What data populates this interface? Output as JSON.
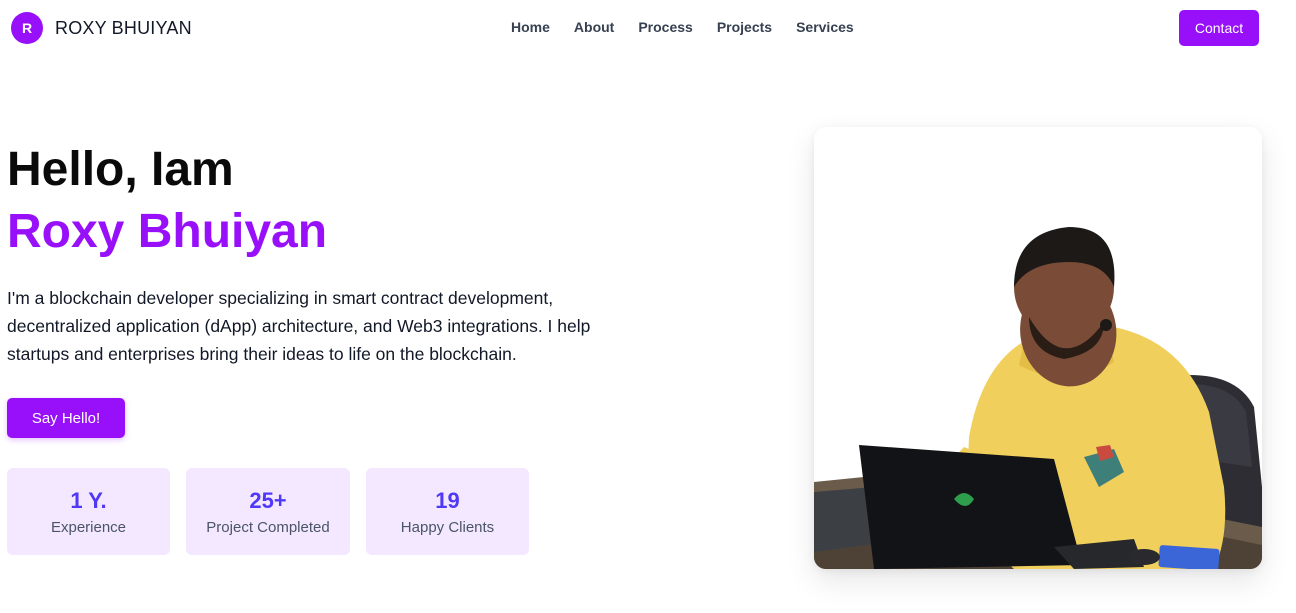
{
  "navbar": {
    "brand_initial": "R",
    "brand_name": "ROXY BHUIYAN",
    "links": [
      "Home",
      "About",
      "Process",
      "Projects",
      "Services"
    ],
    "contact_label": "Contact"
  },
  "hero": {
    "greeting": "Hello, Iam",
    "name": "Roxy Bhuiyan",
    "bio": "I'm a blockchain developer specializing in smart contract development, decentralized application (dApp) architecture, and Web3 integrations. I help startups and enterprises bring their ideas to life on the blockchain.",
    "cta_label": "Say Hello!"
  },
  "stats": [
    {
      "value": "1 Y.",
      "label": "Experience"
    },
    {
      "value": "25+",
      "label": "Project Completed"
    },
    {
      "value": "19",
      "label": "Happy Clients"
    }
  ],
  "colors": {
    "accent": "#9810fa",
    "stat_value": "#4f39f6",
    "stat_bg": "#f3e8ff"
  }
}
